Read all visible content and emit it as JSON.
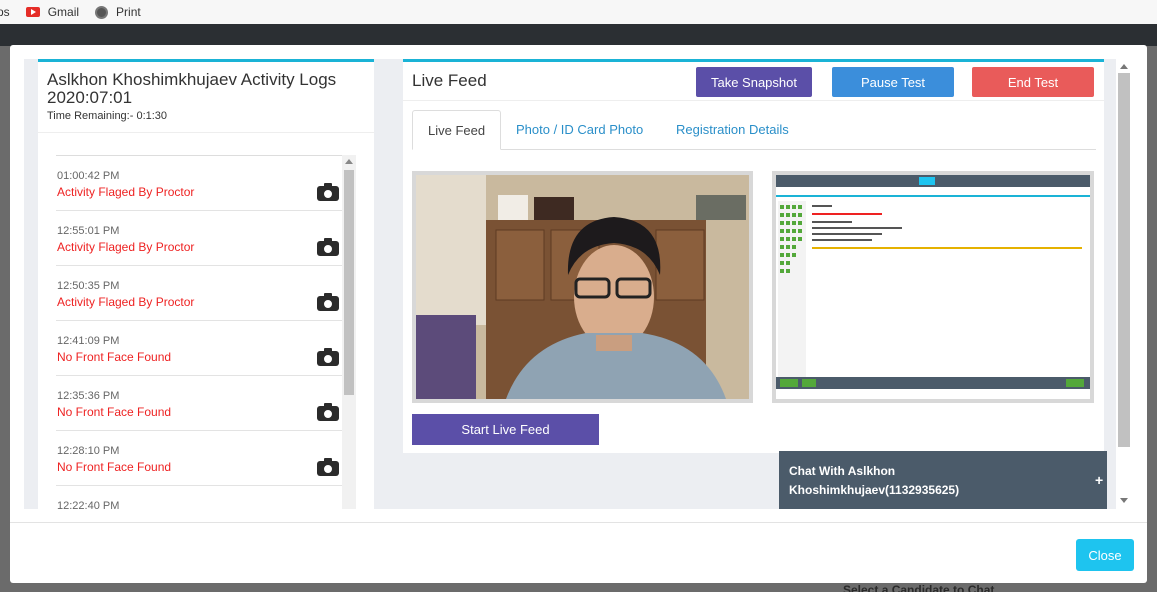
{
  "browser": {
    "bookmarks": [
      {
        "label": "ps",
        "icon": "apps-icon"
      },
      {
        "label": "Gmail",
        "icon": "youtube-icon"
      },
      {
        "label": "Print",
        "icon": "globe-icon"
      }
    ]
  },
  "background": {
    "behind_text": "Select a Candidate to Chat"
  },
  "modal": {
    "close_label": "Close",
    "activity": {
      "title": "Aslkhon Khoshimkhujaev Activity Logs 2020:07:01",
      "time_remaining": "Time Remaining:- 0:1:30",
      "logs": [
        {
          "time": "01:00:42 PM",
          "message": "Activity Flaged By Proctor"
        },
        {
          "time": "12:55:01 PM",
          "message": "Activity Flaged By Proctor"
        },
        {
          "time": "12:50:35 PM",
          "message": "Activity Flaged By Proctor"
        },
        {
          "time": "12:41:09 PM",
          "message": "No Front Face Found"
        },
        {
          "time": "12:35:36 PM",
          "message": "No Front Face Found"
        },
        {
          "time": "12:28:10 PM",
          "message": "No Front Face Found"
        },
        {
          "time": "12:22:40 PM",
          "message": ""
        }
      ]
    },
    "live": {
      "title": "Live Feed",
      "buttons": {
        "snapshot": "Take Snapshot",
        "pause": "Pause Test",
        "end": "End Test"
      },
      "tabs": [
        "Live Feed",
        "Photo / ID Card Photo",
        "Registration Details"
      ],
      "active_tab": "Live Feed",
      "start_button": "Start Live Feed"
    },
    "chat": {
      "title": "Chat With Aslkhon Khoshimkhujaev(1132935625)",
      "expand_symbol": "+"
    }
  },
  "colors": {
    "accent": "#1ab3d6",
    "purple": "#5b4fa8",
    "blue": "#3b8edb",
    "red": "#e95b5a",
    "cyan": "#1ec4ef",
    "alert_text": "#e22222",
    "chat_bg": "#4b5b6a"
  }
}
